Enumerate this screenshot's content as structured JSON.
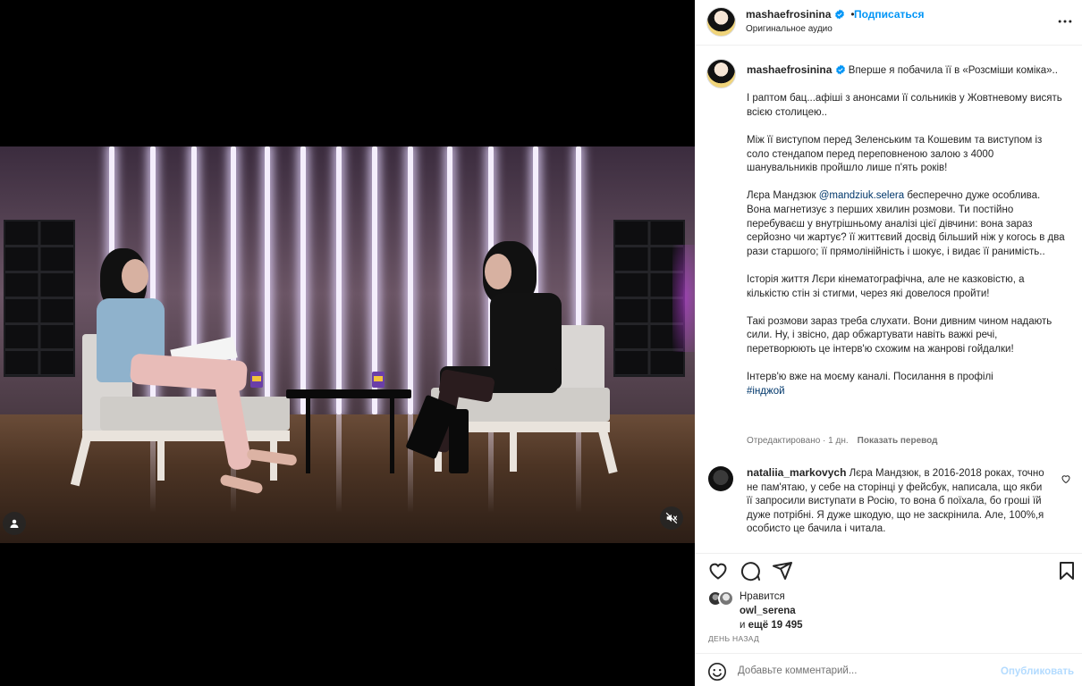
{
  "post": {
    "username": "mashaefrosinina",
    "verified": true,
    "follow_label": "Подписаться",
    "audio_label": "Оригинальное аудио"
  },
  "caption": {
    "lead": "Вперше я побачила її в «Розсміши коміка»..",
    "p1": "І раптом бац...афіші з анонсами її сольників у Жовтневому висять всією столицею..",
    "p2": "Між її виступом перед Зеленським та Кошевим та виступом із соло стендапом перед переповненою залою з 4000 шанувальників пройшло лише п'ять років!",
    "p3_before": "Лєра Мандзюк ",
    "p3_mention": "@mandziuk.selera",
    "p3_after": " беспеpечно дуже особлива. Вона магнетизує з перших хвилин розмови. Ти постійно перебуваєш у внутрішньому аналізі цієї дівчини: вона зараз серйозно чи жартує? її життєвий досвід більший ніж у когось в два рази старшого; її прямолінійність і шокує, і видає її раниміcть..",
    "p4": "Історія життя Лєри кінематографічна, але не казковістю, а кількістю стін зі стигми, через які довелося пройти!",
    "p5": "Такі розмови зараз треба слухати. Вони дивним чином надають сили. Ну, і звісно, дар обжартувати навіть важкі речі, перетворюють це інтерв'ю схожим на жанрові гойдалки!",
    "p6": "Інтерв'ю вже на моєму каналі. Посилання в профілі",
    "hashtag": "#інджой",
    "edited": "Отредактировано · 1 дн.",
    "translate": "Показать перевод"
  },
  "comment": {
    "username": "nataliia_markovych",
    "text": "Лєра Мандзюк, в 2016-2018 роках, точно не пам'ятаю, у себе на сторінці у фейсбук, написала, що якби її запросили виступати в Росію, то вона б поїхала, бо гроші їй дуже потрібні. Я дуже шкодую, що не заскрінила. Але, 100%,я особисто це бачила і читала."
  },
  "likes": {
    "label": "Нравится",
    "first_user": "owl_serena",
    "and_more_prefix": "и ",
    "and_more_count": "ещё 19 495",
    "date": "День назад"
  },
  "comment_box": {
    "placeholder": "Добавьте комментарий...",
    "publish_label": "Опубликовать"
  },
  "icons": {
    "verified": "verified-badge-icon",
    "more": "more-horizontal-icon",
    "like": "heart-icon",
    "comment": "comment-icon",
    "share": "share-icon",
    "save": "bookmark-icon",
    "emoji": "emoji-icon",
    "mute": "mute-icon",
    "tagged_user": "user-tag-icon"
  },
  "colors": {
    "accent": "#0095f6",
    "link": "#00376b",
    "muted": "#737373",
    "publish_disabled": "#b3dbff"
  }
}
